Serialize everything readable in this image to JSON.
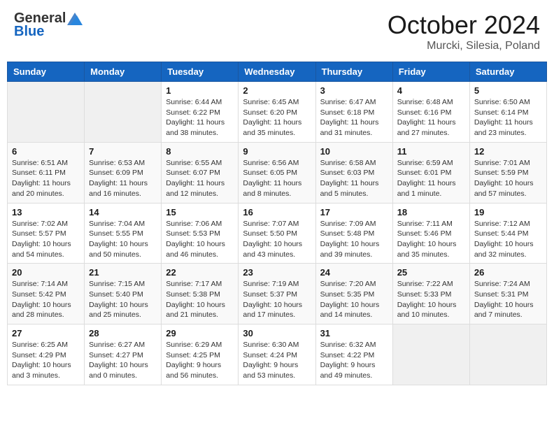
{
  "header": {
    "logo": {
      "general": "General",
      "blue": "Blue"
    },
    "title": "October 2024",
    "location": "Murcki, Silesia, Poland"
  },
  "days_of_week": [
    "Sunday",
    "Monday",
    "Tuesday",
    "Wednesday",
    "Thursday",
    "Friday",
    "Saturday"
  ],
  "weeks": [
    {
      "days": [
        {
          "num": "",
          "info": ""
        },
        {
          "num": "",
          "info": ""
        },
        {
          "num": "1",
          "info": "Sunrise: 6:44 AM\nSunset: 6:22 PM\nDaylight: 11 hours and 38 minutes."
        },
        {
          "num": "2",
          "info": "Sunrise: 6:45 AM\nSunset: 6:20 PM\nDaylight: 11 hours and 35 minutes."
        },
        {
          "num": "3",
          "info": "Sunrise: 6:47 AM\nSunset: 6:18 PM\nDaylight: 11 hours and 31 minutes."
        },
        {
          "num": "4",
          "info": "Sunrise: 6:48 AM\nSunset: 6:16 PM\nDaylight: 11 hours and 27 minutes."
        },
        {
          "num": "5",
          "info": "Sunrise: 6:50 AM\nSunset: 6:14 PM\nDaylight: 11 hours and 23 minutes."
        }
      ]
    },
    {
      "days": [
        {
          "num": "6",
          "info": "Sunrise: 6:51 AM\nSunset: 6:11 PM\nDaylight: 11 hours and 20 minutes."
        },
        {
          "num": "7",
          "info": "Sunrise: 6:53 AM\nSunset: 6:09 PM\nDaylight: 11 hours and 16 minutes."
        },
        {
          "num": "8",
          "info": "Sunrise: 6:55 AM\nSunset: 6:07 PM\nDaylight: 11 hours and 12 minutes."
        },
        {
          "num": "9",
          "info": "Sunrise: 6:56 AM\nSunset: 6:05 PM\nDaylight: 11 hours and 8 minutes."
        },
        {
          "num": "10",
          "info": "Sunrise: 6:58 AM\nSunset: 6:03 PM\nDaylight: 11 hours and 5 minutes."
        },
        {
          "num": "11",
          "info": "Sunrise: 6:59 AM\nSunset: 6:01 PM\nDaylight: 11 hours and 1 minute."
        },
        {
          "num": "12",
          "info": "Sunrise: 7:01 AM\nSunset: 5:59 PM\nDaylight: 10 hours and 57 minutes."
        }
      ]
    },
    {
      "days": [
        {
          "num": "13",
          "info": "Sunrise: 7:02 AM\nSunset: 5:57 PM\nDaylight: 10 hours and 54 minutes."
        },
        {
          "num": "14",
          "info": "Sunrise: 7:04 AM\nSunset: 5:55 PM\nDaylight: 10 hours and 50 minutes."
        },
        {
          "num": "15",
          "info": "Sunrise: 7:06 AM\nSunset: 5:53 PM\nDaylight: 10 hours and 46 minutes."
        },
        {
          "num": "16",
          "info": "Sunrise: 7:07 AM\nSunset: 5:50 PM\nDaylight: 10 hours and 43 minutes."
        },
        {
          "num": "17",
          "info": "Sunrise: 7:09 AM\nSunset: 5:48 PM\nDaylight: 10 hours and 39 minutes."
        },
        {
          "num": "18",
          "info": "Sunrise: 7:11 AM\nSunset: 5:46 PM\nDaylight: 10 hours and 35 minutes."
        },
        {
          "num": "19",
          "info": "Sunrise: 7:12 AM\nSunset: 5:44 PM\nDaylight: 10 hours and 32 minutes."
        }
      ]
    },
    {
      "days": [
        {
          "num": "20",
          "info": "Sunrise: 7:14 AM\nSunset: 5:42 PM\nDaylight: 10 hours and 28 minutes."
        },
        {
          "num": "21",
          "info": "Sunrise: 7:15 AM\nSunset: 5:40 PM\nDaylight: 10 hours and 25 minutes."
        },
        {
          "num": "22",
          "info": "Sunrise: 7:17 AM\nSunset: 5:38 PM\nDaylight: 10 hours and 21 minutes."
        },
        {
          "num": "23",
          "info": "Sunrise: 7:19 AM\nSunset: 5:37 PM\nDaylight: 10 hours and 17 minutes."
        },
        {
          "num": "24",
          "info": "Sunrise: 7:20 AM\nSunset: 5:35 PM\nDaylight: 10 hours and 14 minutes."
        },
        {
          "num": "25",
          "info": "Sunrise: 7:22 AM\nSunset: 5:33 PM\nDaylight: 10 hours and 10 minutes."
        },
        {
          "num": "26",
          "info": "Sunrise: 7:24 AM\nSunset: 5:31 PM\nDaylight: 10 hours and 7 minutes."
        }
      ]
    },
    {
      "days": [
        {
          "num": "27",
          "info": "Sunrise: 6:25 AM\nSunset: 4:29 PM\nDaylight: 10 hours and 3 minutes."
        },
        {
          "num": "28",
          "info": "Sunrise: 6:27 AM\nSunset: 4:27 PM\nDaylight: 10 hours and 0 minutes."
        },
        {
          "num": "29",
          "info": "Sunrise: 6:29 AM\nSunset: 4:25 PM\nDaylight: 9 hours and 56 minutes."
        },
        {
          "num": "30",
          "info": "Sunrise: 6:30 AM\nSunset: 4:24 PM\nDaylight: 9 hours and 53 minutes."
        },
        {
          "num": "31",
          "info": "Sunrise: 6:32 AM\nSunset: 4:22 PM\nDaylight: 9 hours and 49 minutes."
        },
        {
          "num": "",
          "info": ""
        },
        {
          "num": "",
          "info": ""
        }
      ]
    }
  ]
}
